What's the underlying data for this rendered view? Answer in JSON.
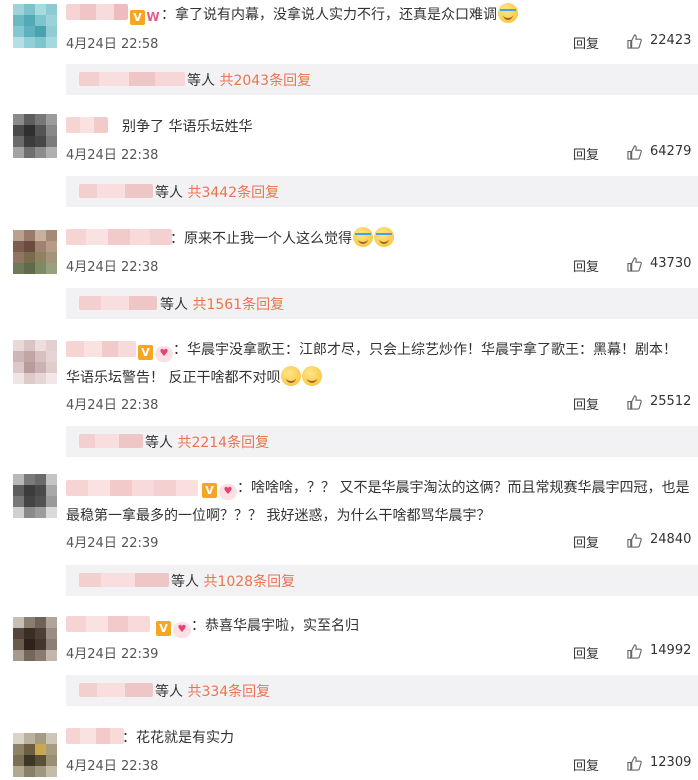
{
  "comments": [
    {
      "text": "拿了说有内幕，没拿说人实力不行，还真是众口难调",
      "date": "4月24日 22:58",
      "reply_label": "回复",
      "likes": "22423",
      "sub_prefix": "等人",
      "sub_count": "共2043条回复"
    },
    {
      "text": "别争了 华语乐坛姓华",
      "date": "4月24日 22:38",
      "reply_label": "回复",
      "likes": "64279",
      "sub_prefix": "等人",
      "sub_count": "共3442条回复"
    },
    {
      "text": "：原来不止我一个人这么觉得",
      "date": "4月24日 22:38",
      "reply_label": "回复",
      "likes": "43730",
      "sub_prefix": "等人",
      "sub_count": "共1561条回复"
    },
    {
      "text": "华晨宇没拿歌王：江郎才尽，只会上综艺炒作！华晨宇拿了歌王：黑幕！剧本！华语乐坛警告！ 反正干啥都不对呗",
      "date": "4月24日 22:38",
      "reply_label": "回复",
      "likes": "25512",
      "sub_prefix": "等人",
      "sub_count": "共2214条回复"
    },
    {
      "text": "啥啥啥，？？ 又不是华晨宇淘汰的这俩？而且常规赛华晨宇四冠，也是最稳第一拿最多的一位啊？？？ 我好迷惑，为什么干啥都骂华晨宇？",
      "date": "4月24日 22:39",
      "reply_label": "回复",
      "likes": "24840",
      "sub_prefix": "等人",
      "sub_count": "共1028条回复"
    },
    {
      "text": "：恭喜华晨宇啦，实至名归",
      "date": "4月24日 22:39",
      "reply_label": "回复",
      "likes": "14992",
      "sub_prefix": "等人",
      "sub_count": "共334条回复"
    },
    {
      "text": "：花花就是有实力",
      "date": "4月24日 22:38",
      "reply_label": "回复",
      "likes": "12309"
    }
  ],
  "colors": {
    "accent": "#eb7350",
    "sub_bg": "#f2f2f5",
    "text": "#333333",
    "meta": "#555555"
  },
  "icons": {
    "like": "thumbs-up-icon",
    "verified": "verified-v-icon",
    "emoji_laugh_cry": "laugh-cry-emoji",
    "emoji_think": "thinking-emoji"
  }
}
